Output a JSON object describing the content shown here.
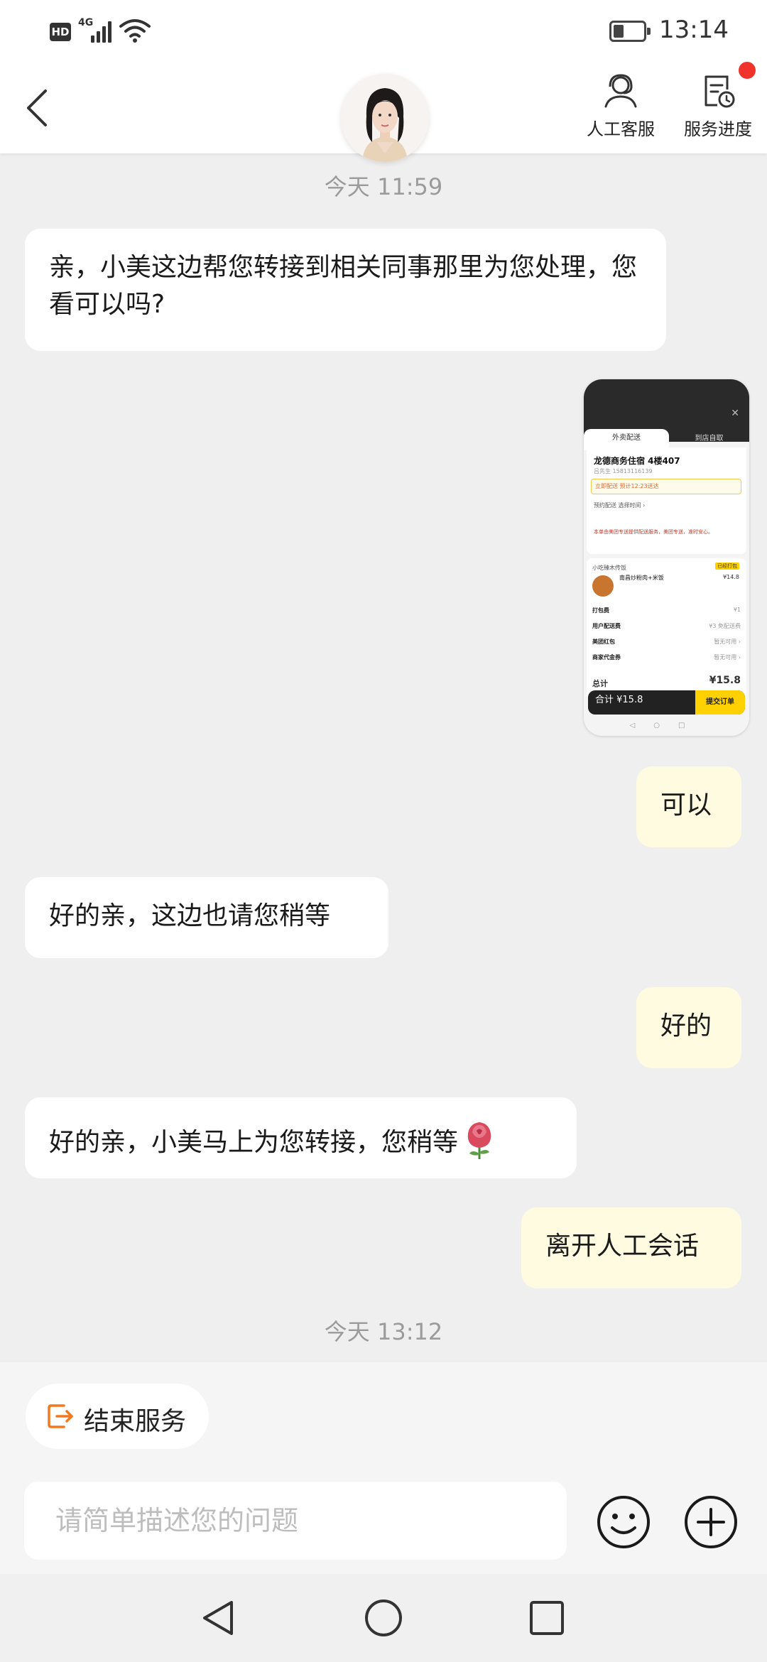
{
  "status_bar": {
    "hd": "HD",
    "network": "4G",
    "time": "13:14",
    "icons": [
      "signal-icon",
      "wifi-icon",
      "battery-icon"
    ]
  },
  "header": {
    "back_icon": "chevron-left-icon",
    "avatar": "agent-avatar",
    "customer_service_label": "人工客服",
    "customer_service_icon": "headset-person-icon",
    "service_progress_label": "服务进度",
    "service_progress_icon": "document-clock-icon",
    "notification_color": "#f0342c"
  },
  "chat": {
    "timestamp_1": "今天 11:59",
    "msg_1": "亲，小美这边帮您转接到相关同事那里为您处理，您看可以吗?",
    "screenshot": {
      "tab_delivery": "外卖配送",
      "tab_pickup": "到店自取",
      "address": "龙德商务住宿 4楼407",
      "contact": "吕先生 15813116139",
      "delivery_option": "立即配送    预计12:23送达",
      "preorder": "预约配送    选择时间 ›",
      "note": "本单由美团专送提供配送服务，美团专送，准时安心。",
      "shop": "小吃臻木传饭",
      "badge": "已经打包",
      "dish": "南昌炒粉肉+米饭",
      "dish_price": "¥14.8",
      "packing_label": "打包费",
      "packing_value": "¥1",
      "delivery_fee_label": "用户配送费",
      "delivery_fee_value": "¥3 免配送费",
      "redpacket_label": "美团红包",
      "redpacket_value": "暂无可用 ›",
      "voucher_label": "商家代金券",
      "voucher_value": "暂无可用 ›",
      "total_label": "总计",
      "total_value": "¥15.8",
      "bottom_price": "合计 ¥15.8",
      "submit_label": "提交订单",
      "nav_glyphs": "◁○□"
    },
    "msg_2": "可以",
    "msg_3": "好的亲，这边也请您稍等",
    "msg_4": "好的",
    "msg_5": "好的亲，小美马上为您转接，您稍等",
    "msg_5_emoji": "rose-icon",
    "msg_6": "离开人工会话",
    "timestamp_2": "今天 13:12",
    "bubble_in_color": "#ffffff",
    "bubble_out_color": "#fefbe0"
  },
  "bottom": {
    "end_service_label": "结束服务",
    "end_service_icon": "exit-icon",
    "input_placeholder": "请简单描述您的问题",
    "emoji_icon": "smiley-icon",
    "plus_icon": "plus-circle-icon",
    "accent_color": "#f0791e"
  },
  "nav_bar": {
    "icons": [
      "nav-back-icon",
      "nav-home-icon",
      "nav-recent-icon"
    ]
  }
}
